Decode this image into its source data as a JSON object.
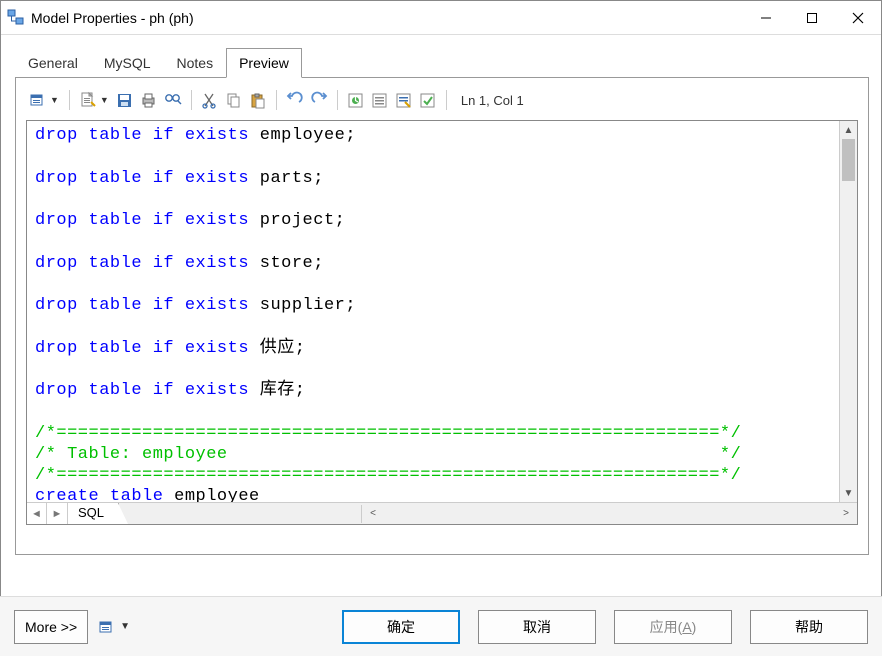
{
  "window": {
    "title": "Model Properties - ph (ph)"
  },
  "tabs": [
    {
      "label": "General"
    },
    {
      "label": "MySQL"
    },
    {
      "label": "Notes"
    },
    {
      "label": "Preview"
    }
  ],
  "active_tab": 3,
  "cursor_position": "Ln 1, Col 1",
  "toolbar_icons": [
    "edit-tool",
    "new-doc",
    "save",
    "print",
    "find",
    "cut",
    "copy",
    "paste",
    "undo",
    "redo",
    "tgl1",
    "tgl2",
    "tgl3",
    "tgl4"
  ],
  "code": {
    "lines": [
      {
        "t": "stmt",
        "kw": "drop table if exists",
        "id": "employee",
        "tail": ";"
      },
      {
        "t": "blank"
      },
      {
        "t": "stmt",
        "kw": "drop table if exists",
        "id": "parts",
        "tail": ";"
      },
      {
        "t": "blank"
      },
      {
        "t": "stmt",
        "kw": "drop table if exists",
        "id": "project",
        "tail": ";"
      },
      {
        "t": "blank"
      },
      {
        "t": "stmt",
        "kw": "drop table if exists",
        "id": "store",
        "tail": ";"
      },
      {
        "t": "blank"
      },
      {
        "t": "stmt",
        "kw": "drop table if exists",
        "id": "supplier",
        "tail": ";"
      },
      {
        "t": "blank"
      },
      {
        "t": "stmt",
        "kw": "drop table if exists",
        "id": "供应",
        "tail": ";"
      },
      {
        "t": "blank"
      },
      {
        "t": "stmt",
        "kw": "drop table if exists",
        "id": "库存",
        "tail": ";"
      },
      {
        "t": "blank"
      },
      {
        "t": "comment",
        "text": "/*==============================================================*/"
      },
      {
        "t": "comment",
        "text": "/* Table: employee                                              */"
      },
      {
        "t": "comment",
        "text": "/*==============================================================*/"
      },
      {
        "t": "stmt",
        "kw": "create table",
        "id": "employee",
        "tail": ""
      }
    ]
  },
  "editor_tab": "SQL",
  "buttons": {
    "more": "More >>",
    "ok": "确定",
    "cancel": "取消",
    "apply_prefix": "应用(",
    "apply_hotkey": "A",
    "apply_suffix": ")",
    "help": "帮助"
  }
}
